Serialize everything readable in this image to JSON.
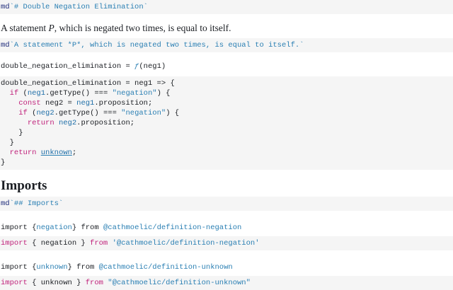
{
  "cells": {
    "c1_code": {
      "md": "md",
      "template": "`# Double Negation Elimination`"
    },
    "c2_para": {
      "before": "A statement ",
      "var": "P",
      "after": ", which is negated two times, is equal to itself."
    },
    "c2_code": {
      "md": "md",
      "template": "`A statement *P*, which is negated two times, is equal to itself.`"
    },
    "c3_out": {
      "name": "double_negation_elimination",
      "eq": " = ",
      "f": "ƒ",
      "args": "(neg1)"
    },
    "c3_code": {
      "l1": "double_negation_elimination = neg1 => {",
      "l2_a": "  ",
      "l2_kw": "if",
      "l2_b": " (",
      "l2_id": "neg1",
      "l2_c": ".getType() === ",
      "l2_str": "\"negation\"",
      "l2_d": ") {",
      "l3_a": "    ",
      "l3_kw": "const",
      "l3_b": " neg2 = ",
      "l3_id": "neg1",
      "l3_c": ".proposition;",
      "l4_a": "    ",
      "l4_kw": "if",
      "l4_b": " (",
      "l4_id": "neg2",
      "l4_c": ".getType() === ",
      "l4_str": "\"negation\"",
      "l4_d": ") {",
      "l5_a": "      ",
      "l5_kw": "return",
      "l5_b": " ",
      "l5_id": "neg2",
      "l5_c": ".proposition;",
      "l6": "    }",
      "l7": "  }",
      "l8_a": "  ",
      "l8_kw": "return",
      "l8_b": " ",
      "l8_id": "unknown",
      "l8_c": ";",
      "l9": "}"
    },
    "c4_heading": "Imports",
    "c4_code": {
      "md": "md",
      "template": "`## Imports`"
    },
    "c5_out": {
      "kw": "import",
      "open": " {",
      "name": "negation",
      "close": "} ",
      "from": "from",
      "sp": " ",
      "path": "@cathmoelic/definition-negation"
    },
    "c5_code": {
      "kw": "import",
      "mid": " { negation } ",
      "from": "from",
      "sp": " ",
      "path": "'@cathmoelic/definition-negation'"
    },
    "c6_out": {
      "kw": "import",
      "open": " {",
      "name": "unknown",
      "close": "} ",
      "from": "from",
      "sp": " ",
      "path": "@cathmoelic/definition-unknown"
    },
    "c6_code": {
      "kw": "import",
      "mid": " { unknown } ",
      "from": "from",
      "sp": " ",
      "path": "\"@cathmoelic/definition-unknown\""
    }
  },
  "colors": {
    "keyword": "#c0227b",
    "string": "#2a7fb3",
    "identifier": "#1e6ea8",
    "cell_background": "#f5f5f5"
  }
}
